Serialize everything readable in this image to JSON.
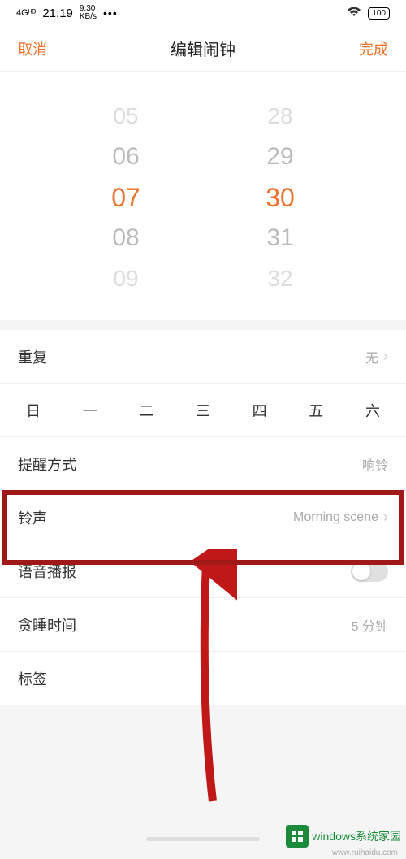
{
  "status": {
    "network": "4Gᴴᴰ",
    "time": "21:19",
    "speed_top": "9.30",
    "speed_bottom": "KB/s",
    "dots": "•••",
    "battery": "100"
  },
  "nav": {
    "cancel": "取消",
    "title": "编辑闹钟",
    "done": "完成"
  },
  "picker": {
    "hours": [
      "05",
      "06",
      "07",
      "08",
      "09"
    ],
    "minutes": [
      "28",
      "29",
      "30",
      "31",
      "32"
    ]
  },
  "rows": {
    "repeat": {
      "label": "重复",
      "value": "无"
    },
    "reminder": {
      "label": "提醒方式",
      "value": "响铃"
    },
    "ringtone": {
      "label": "铃声",
      "value": "Morning scene"
    },
    "voice": {
      "label": "语音播报"
    },
    "snooze": {
      "label": "贪睡时间",
      "value": "5 分钟"
    },
    "tag": {
      "label": "标签"
    }
  },
  "weekdays": [
    "日",
    "一",
    "二",
    "三",
    "四",
    "五",
    "六"
  ],
  "watermark": {
    "text": "windows系统家园",
    "sub": "www.ruihaidu.com"
  }
}
